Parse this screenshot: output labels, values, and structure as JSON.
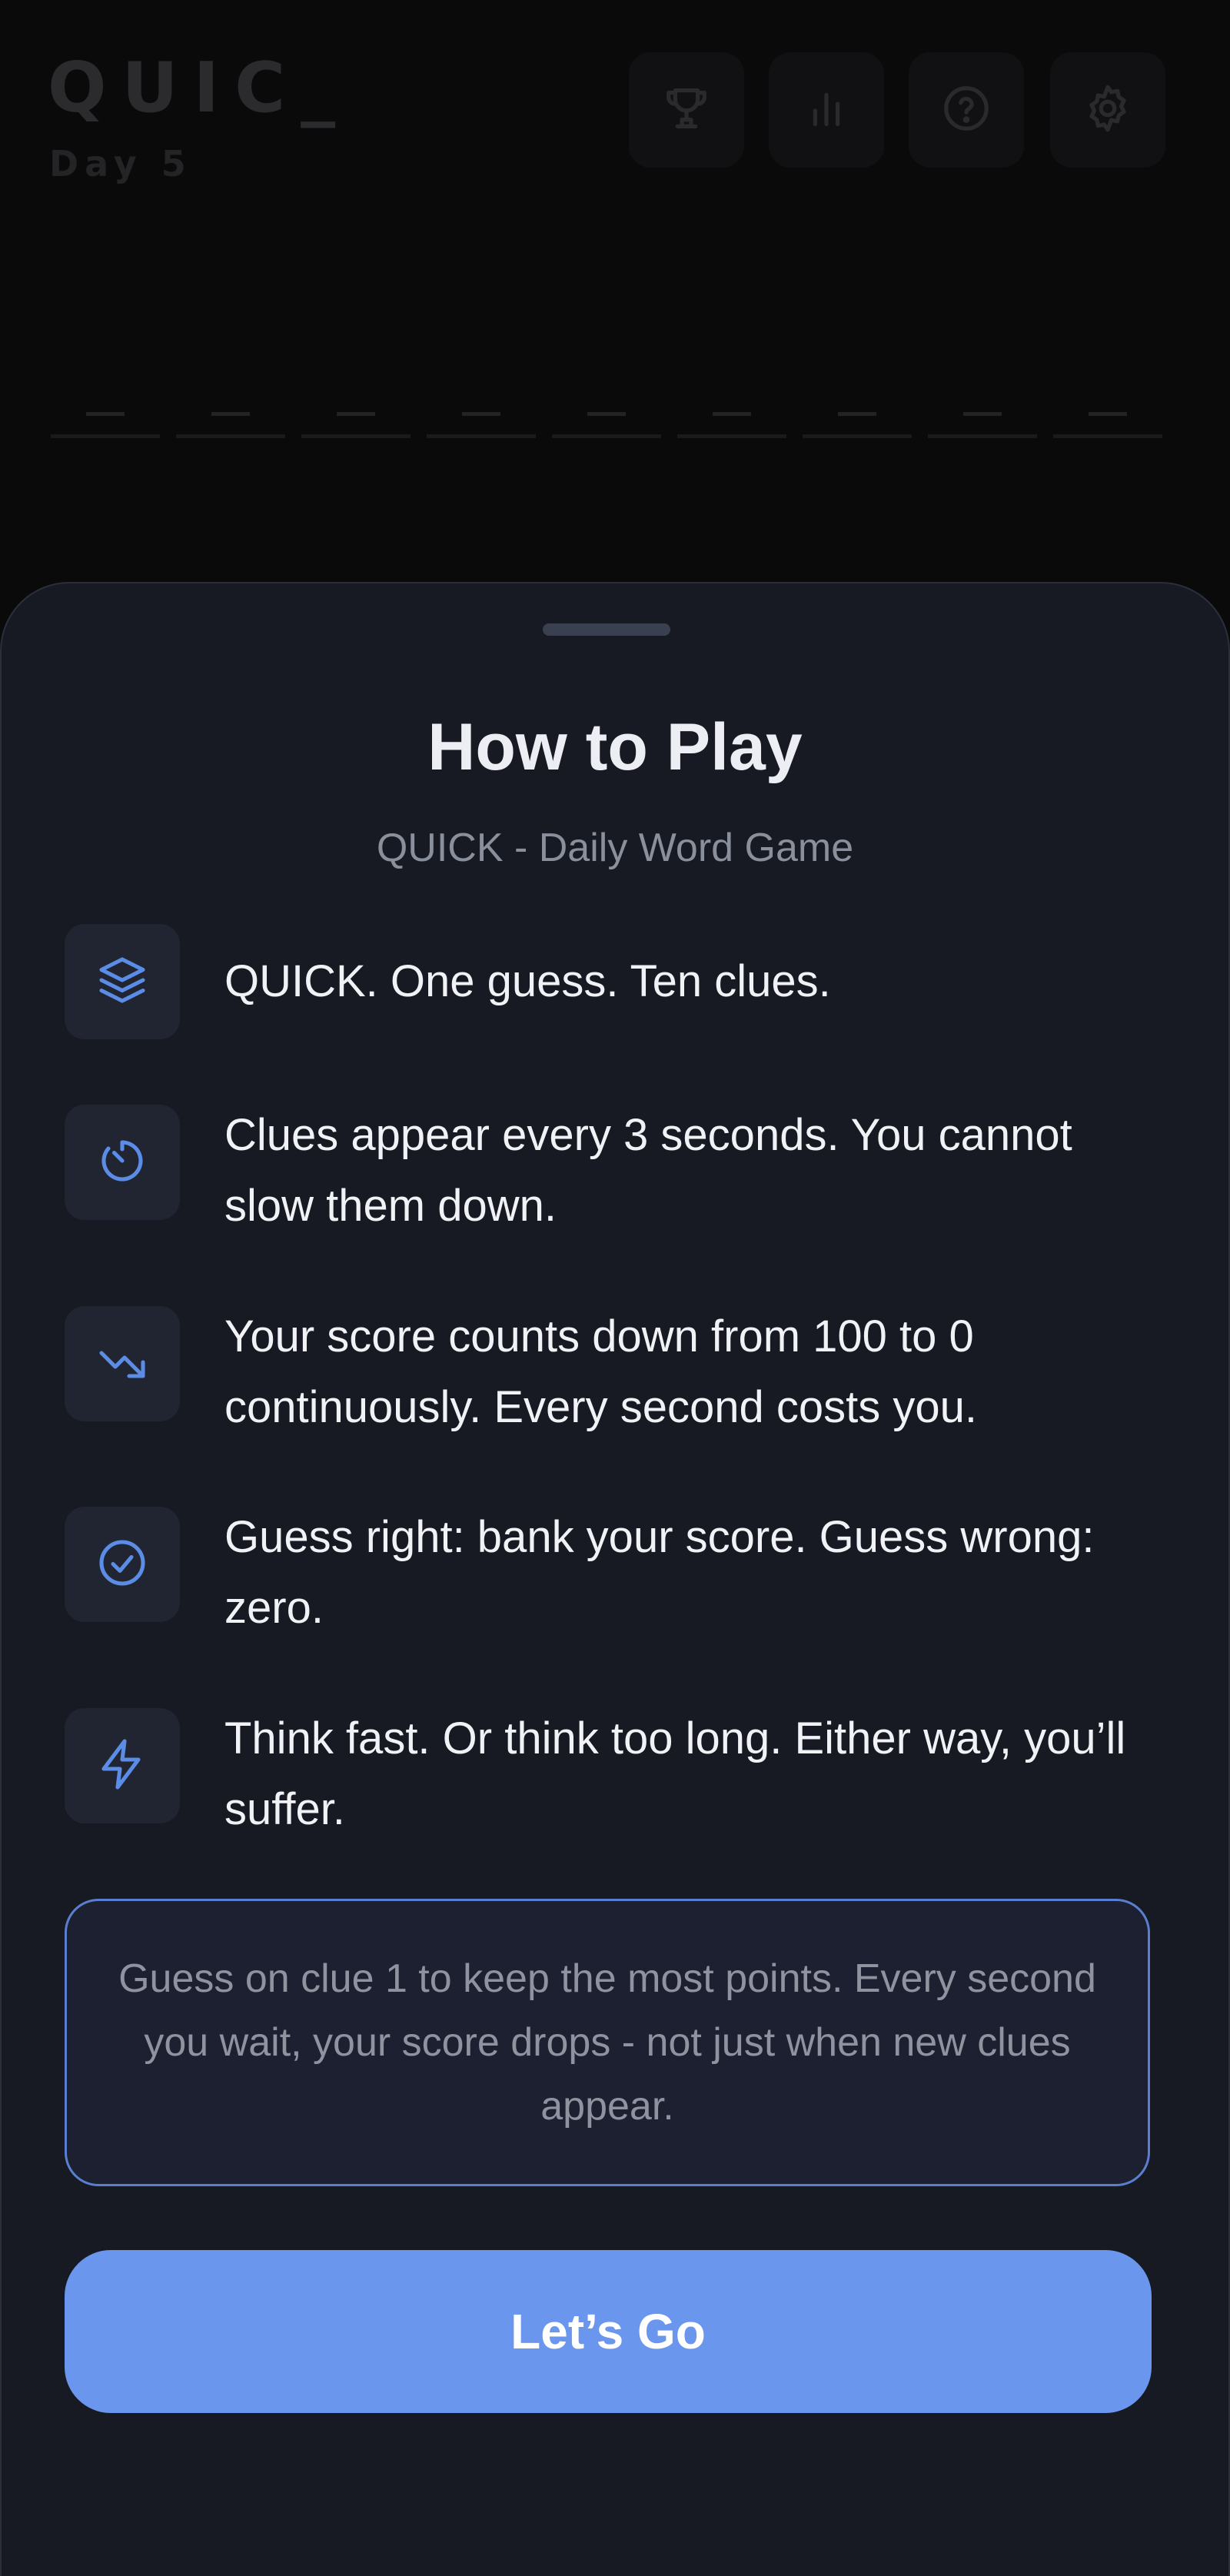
{
  "game": {
    "logo": "QUIC_",
    "day": "Day 5",
    "header_buttons": [
      {
        "icon": "trophy-icon"
      },
      {
        "icon": "bar-chart-icon"
      },
      {
        "icon": "help-circle-icon"
      },
      {
        "icon": "gear-icon"
      }
    ],
    "answer_slots": 9
  },
  "modal": {
    "title": "How to Play",
    "subtitle": "QUICK - Daily Word Game",
    "rules": [
      {
        "icon": "layers-icon",
        "text": "QUICK. One guess. Ten clues."
      },
      {
        "icon": "timer-icon",
        "text": "Clues appear every 3 seconds. You cannot slow them down."
      },
      {
        "icon": "trending-down-icon",
        "text": "Your score counts down from 100 to 0 continuously. Every second costs you."
      },
      {
        "icon": "check-circle-icon",
        "text": "Guess right: bank your score. Guess wrong: zero."
      },
      {
        "icon": "lightning-icon",
        "text": "Think fast. Or think too long. Either way, you’ll suffer."
      }
    ],
    "tip": "Guess on clue 1 to keep the most points. Every second you wait, your score drops - not just when new clues appear.",
    "button_label": "Let’s Go"
  },
  "colors": {
    "accent": "#6a96ee",
    "icon_blue": "#5b8ce6",
    "sheet_bg": "#171a22",
    "page_bg": "#0a0a0b"
  }
}
